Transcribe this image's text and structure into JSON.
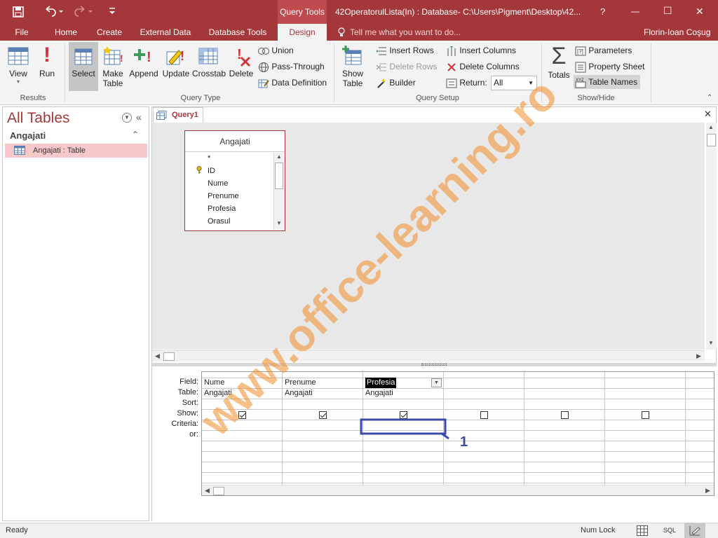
{
  "titlebar": {
    "context_tab": "Query Tools",
    "title": "42OperatorulLista(In) : Database- C:\\Users\\Pigment\\Desktop\\42...",
    "help": "?",
    "minimize": "—",
    "maximize": "☐",
    "close": "✕"
  },
  "tabs": [
    "File",
    "Home",
    "Create",
    "External Data",
    "Database Tools",
    "Design"
  ],
  "tell_me": "Tell me what you want to do...",
  "user": "Florin-Ioan Coşug",
  "ribbon": {
    "view": "View",
    "run": "Run",
    "select": "Select",
    "make_table_1": "Make",
    "make_table_2": "Table",
    "append": "Append",
    "update": "Update",
    "crosstab": "Crosstab",
    "delete": "Delete",
    "union": "Union",
    "pass_through": "Pass-Through",
    "data_definition": "Data Definition",
    "show_table_1": "Show",
    "show_table_2": "Table",
    "insert_rows": "Insert Rows",
    "delete_rows": "Delete Rows",
    "builder": "Builder",
    "insert_columns": "Insert Columns",
    "delete_columns": "Delete Columns",
    "return_label": "Return:",
    "return_value": "All",
    "totals": "Totals",
    "parameters": "Parameters",
    "property_sheet": "Property Sheet",
    "table_names": "Table Names",
    "groups": {
      "results": "Results",
      "query_type": "Query Type",
      "query_setup": "Query Setup",
      "show_hide": "Show/Hide"
    }
  },
  "nav": {
    "title": "All Tables",
    "group": "Angajati",
    "item": "Angajati : Table"
  },
  "query_tab": "Query1",
  "table_box": {
    "title": "Angajati",
    "fields": [
      "*",
      "ID",
      "Nume",
      "Prenume",
      "Profesia",
      "Orasul"
    ]
  },
  "grid": {
    "row_labels": [
      "Field:",
      "Table:",
      "Sort:",
      "Show:",
      "Criteria:",
      "or:"
    ],
    "columns": [
      {
        "field": "Nume",
        "table": "Angajati",
        "show": true
      },
      {
        "field": "Prenume",
        "table": "Angajati",
        "show": true
      },
      {
        "field": "Profesia",
        "table": "Angajati",
        "show": true
      },
      {
        "field": "",
        "table": "",
        "show": false
      },
      {
        "field": "",
        "table": "",
        "show": false
      },
      {
        "field": "",
        "table": "",
        "show": false
      }
    ]
  },
  "annotation": "1",
  "watermark": "www.office-learning.ro",
  "status": {
    "left": "Ready",
    "num_lock": "Num Lock",
    "sql": "SQL"
  },
  "colors": {
    "accent": "#a4373a",
    "highlight_box": "#3b4ba8",
    "watermark": "#f28c28"
  }
}
